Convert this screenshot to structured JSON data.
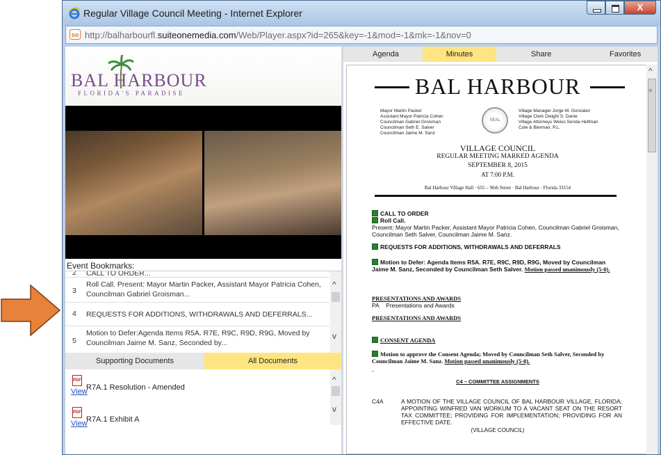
{
  "window": {
    "title": "Regular Village Council Meeting - Internet Explorer",
    "address": {
      "prefix": "http://balharbourfl.",
      "domain": "suiteonemedia.com",
      "suffix": "/Web/Player.aspx?id=265&key=-1&mod=-1&mk=-1&nov=0"
    },
    "close_glyph": "X"
  },
  "logo": {
    "name": "BAL HARBOUR",
    "tagline": "FLORIDA'S PARADISE"
  },
  "bookmarks": {
    "label": "Event Bookmarks:",
    "items": [
      {
        "num": "2",
        "text": "CALL TO ORDER..."
      },
      {
        "num": "3",
        "text": "Roll Call. Present: Mayor Martin Packer, Assistant Mayor Patricia Cohen, Councilman Gabriel Groisman..."
      },
      {
        "num": "4",
        "text": "REQUESTS FOR ADDITIONS, WITHDRAWALS AND DEFERRALS..."
      },
      {
        "num": "5",
        "text": "Motion to Defer:Agenda Items R5A. R7E, R9C, R9D, R9G, Moved by Councilman Jaime M. Sanz, Seconded by..."
      }
    ]
  },
  "doc_tabs": {
    "supporting": "Supporting Documents",
    "all": "All Documents"
  },
  "documents": [
    {
      "name": "R7A.1 Resolution - Amended",
      "link": "View"
    },
    {
      "name": "R7A.1 Exhibit A",
      "link": "View"
    }
  ],
  "tabs": {
    "agenda": "Agenda",
    "minutes": "Minutes",
    "share": "Share",
    "favorites": "Favorites"
  },
  "minutes_doc": {
    "title": "BAL HARBOUR",
    "officials_left": [
      "Mayor Martin Packer",
      "Assistant Mayor Patricia Cohen",
      "Councilman Gabriel Groisman",
      "Councilman Seth E. Salver",
      "Councilman Jaime M. Sanz"
    ],
    "officials_right": [
      "Village Manager Jorge M. Gonzalez",
      "Village Clerk Dwight S. Danie",
      "Village Attorneys Weiss Serota Helfman",
      "Cole & Bierman, P.L."
    ],
    "seal_text": "SEAL",
    "council": "VILLAGE COUNCIL",
    "agenda_type": "REGULAR MEETING MARKED AGENDA",
    "date": "SEPTEMBER 8, 2015",
    "time": "AT 7:00 P.M.",
    "location": "Bal Harbour Village Hall · 655 – 96th Street · Bal Harbour · Florida 33154",
    "call_to_order": "CALL TO ORDER",
    "roll_call": "Roll Call.",
    "present": "Present: Mayor Martin Packer, Assistant Mayor Patricia Cohen, Councilman Gabriel Groisman, Councilman Seth Salver, Councilman Jaime M. Sanz.",
    "requests": "REQUESTS FOR ADDITIONS, WITHDRAWALS AND DEFERRALS",
    "motion_defer": "Motion to Defer: Agenda Items R5A. R7E, R9C, R9D, R9G, Moved by Councilman Jaime M. Sanz, Seconded by Councilman Seth Salver.",
    "motion_defer_result": "Motion passed unanimously (5-0).",
    "presentations": "PRESENTATIONS AND AWARDS",
    "pa_code": "PA",
    "pa_text": "Presentations and Awards",
    "presentations2": "PRESENTATIONS AND AWARDS",
    "consent": "CONSENT AGENDA",
    "motion_consent": "Motion to approve the Consent Agenda; Moved by Councilman Seth Salver, Seconded by Councilman Jaime M. Sanz.",
    "motion_consent_result": "Motion passed unanimously (5-0).",
    "dash": "-",
    "c4": "C4 – COMMITTEE ASSIGNMENTS",
    "c4a_code": "C4A",
    "c4a_text": "A MOTION OF THE VILLAGE COUNCIL OF BAL HARBOUR VILLAGE, FLORIDA; APPOINTING WINFRED VAN WORKUM TO A VACANT SEAT ON THE RESORT TAX COMMITTEE; PROVIDING FOR IMPLEMENTATION; PROVIDING FOR AN EFFECTIVE DATE.",
    "c4a_by": "(VILLAGE COUNCIL)"
  },
  "colors": {
    "arrow": "#e8813a",
    "highlight_tab": "#ffe482",
    "titlebar": "#b9d1ea"
  }
}
